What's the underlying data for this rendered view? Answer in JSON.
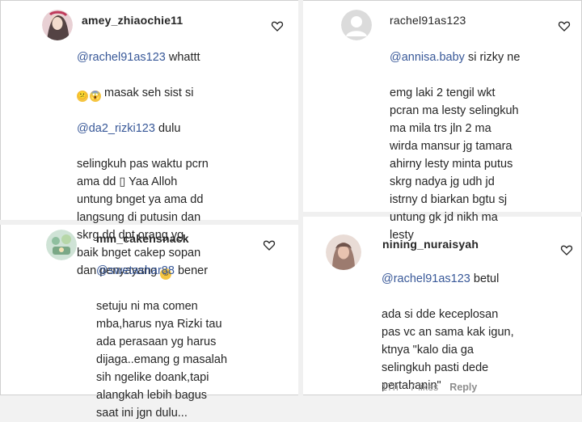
{
  "comments": [
    {
      "username": "amey_zhiaochie11",
      "mention": "@rachel91as123",
      "after_mention": " whattt",
      "line2_text": " masak seh sist si",
      "mention2": "@da2_rizki123",
      "after_mention2": " dulu",
      "rest": "selingkuh pas waktu pcrn\nama dd ▯ Yaa Alloh\nuntung bnget ya ama dd\nlangsung di putusin dan\nskrg dd dpt orang yg\nbaik bnget cakep sopan\ndan penyayang",
      "emoji_1": "😕",
      "emoji_2": "😱",
      "emoji_3": "☺"
    },
    {
      "username": "rachel91as123",
      "mention": "@annisa.baby",
      "after_mention": " si rizky ne",
      "rest": "emg laki 2 tengil wkt\npcran ma lesty selingkuh\nma mila trs jln 2 ma\nwirda mansur jg tamara\nahirny lesty minta putus\nskrg nadya jg udh jd\nistrny d biarkan bgtu sj\nuntung gk jd nikh ma\nlesty"
    },
    {
      "username": "mm_cakensnack",
      "mention": "@swetashar88",
      "after_mention": " bener",
      "rest": "setuju ni ma comen\nmba,harus nya Rizki tau\nada perasaan yg harus\ndijaga..emang g masalah\nsih ngelike doank,tapi\nalangkah lebih bagus\nsaat ini jgn dulu..."
    },
    {
      "username": "nining_nuraisyah",
      "mention": "@rachel91as123",
      "after_mention": " betul",
      "rest": "ada si dde keceplosan\npas vc an sama kak igun,\nktnya \"kalo dia ga\nselingkuh pasti dede\npertahanin\"",
      "meta": {
        "time": "17h",
        "likes": "7 likes",
        "reply": "Reply"
      }
    }
  ],
  "icons": {
    "like": "heart-icon",
    "avatar": "avatar"
  },
  "colors": {
    "mention": "#385898",
    "text": "#262626",
    "meta": "#8e8e8e"
  }
}
